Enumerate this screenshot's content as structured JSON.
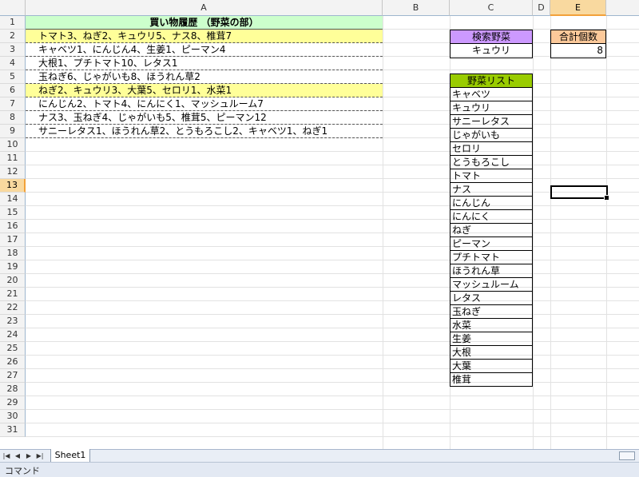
{
  "columns": [
    "A",
    "B",
    "C",
    "D",
    "E"
  ],
  "rows": [
    "1",
    "2",
    "3",
    "4",
    "5",
    "6",
    "7",
    "8",
    "9",
    "10",
    "11",
    "12",
    "13",
    "14",
    "15",
    "16",
    "17",
    "18",
    "19",
    "20",
    "21",
    "22",
    "23",
    "24",
    "25",
    "26",
    "27",
    "28",
    "29",
    "30",
    "31"
  ],
  "history": {
    "title": "買い物履歴 （野菜の部）",
    "entries": [
      "トマト3、ねぎ2、キュウリ5、ナス8、椎茸7",
      "キャベツ1、にんじん4、生姜1、ピーマン4",
      "大根1、プチトマト10、レタス1",
      "玉ねぎ6、じゃがいも8、ほうれん草2",
      "ねぎ2、キュウリ3、大葉5、セロリ1、水菜1",
      "にんじん2、トマト4、にんにく1、マッシュルーム7",
      "ナス3、玉ねぎ4、じゃがいも5、椎茸5、ピーマン12",
      "サニーレタス1、ほうれん草2、とうもろこし2、キャベツ1、ねぎ1"
    ]
  },
  "search": {
    "label": "検索野菜",
    "value": "キュウリ"
  },
  "total": {
    "label": "合計個数",
    "value": "8"
  },
  "veg_list": {
    "title": "野菜リスト",
    "items": [
      "キャベツ",
      "キュウリ",
      "サニーレタス",
      "じゃがいも",
      "セロリ",
      "とうもろこし",
      "トマト",
      "ナス",
      "にんじん",
      "にんにく",
      "ねぎ",
      "ピーマン",
      "プチトマト",
      "ほうれん草",
      "マッシュルーム",
      "レタス",
      "玉ねぎ",
      "水菜",
      "生姜",
      "大根",
      "大葉",
      "椎茸"
    ]
  },
  "sheet_tab": "Sheet1",
  "status": "コマンド",
  "colors": {
    "history_title": "#ccffcc",
    "highlight": "#ffff99",
    "search_label": "#cc99ff",
    "total_label": "#fcc99a",
    "list_title": "#99cc00"
  }
}
